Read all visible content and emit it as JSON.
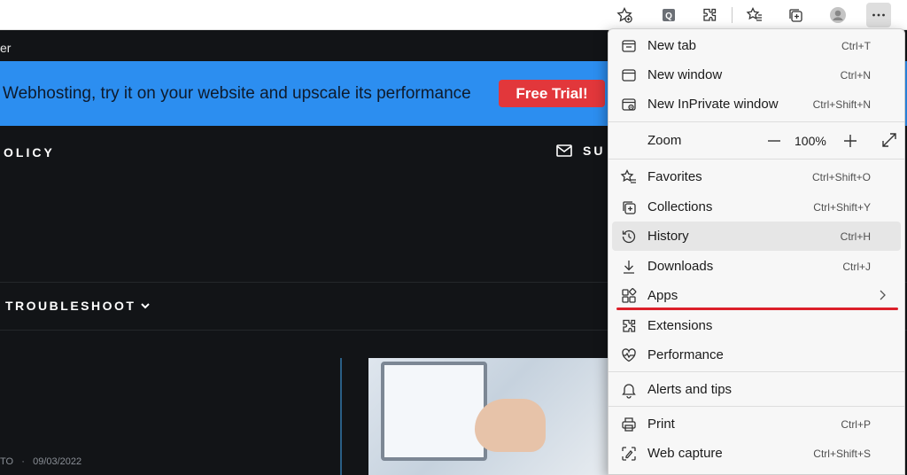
{
  "toolbar": {
    "icons": [
      "add-favorite-icon",
      "extension-q-icon",
      "extensions-icon",
      "favorites-icon",
      "collections-icon",
      "profile-icon",
      "more-icon"
    ]
  },
  "page": {
    "site_title": "er",
    "banner_text": "Webhosting, try it on your website and upscale its performance",
    "free_trial_label": "Free Trial!",
    "nav_policy": "OLICY",
    "nav_subscribe": "SU",
    "nav_troubleshoot": "TROUBLESHOOT",
    "post_author_fragment": "TO",
    "post_date": "09/03/2022",
    "post_meta_separator": "·"
  },
  "menu": {
    "new_tab": {
      "label": "New tab",
      "shortcut": "Ctrl+T"
    },
    "new_window": {
      "label": "New window",
      "shortcut": "Ctrl+N"
    },
    "new_inprivate": {
      "label": "New InPrivate window",
      "shortcut": "Ctrl+Shift+N"
    },
    "zoom": {
      "label": "Zoom",
      "value": "100%"
    },
    "favorites": {
      "label": "Favorites",
      "shortcut": "Ctrl+Shift+O"
    },
    "collections": {
      "label": "Collections",
      "shortcut": "Ctrl+Shift+Y"
    },
    "history": {
      "label": "History",
      "shortcut": "Ctrl+H"
    },
    "downloads": {
      "label": "Downloads",
      "shortcut": "Ctrl+J"
    },
    "apps": {
      "label": "Apps"
    },
    "extensions": {
      "label": "Extensions"
    },
    "performance": {
      "label": "Performance"
    },
    "alerts": {
      "label": "Alerts and tips"
    },
    "print": {
      "label": "Print",
      "shortcut": "Ctrl+P"
    },
    "web_capture": {
      "label": "Web capture",
      "shortcut": "Ctrl+Shift+S"
    }
  },
  "colors": {
    "banner": "#2c8ef0",
    "free_trial": "#e2373b",
    "page_bg": "#121417",
    "menu_bg": "#f7f7f7",
    "highlight_underline": "#dc1f2a"
  }
}
